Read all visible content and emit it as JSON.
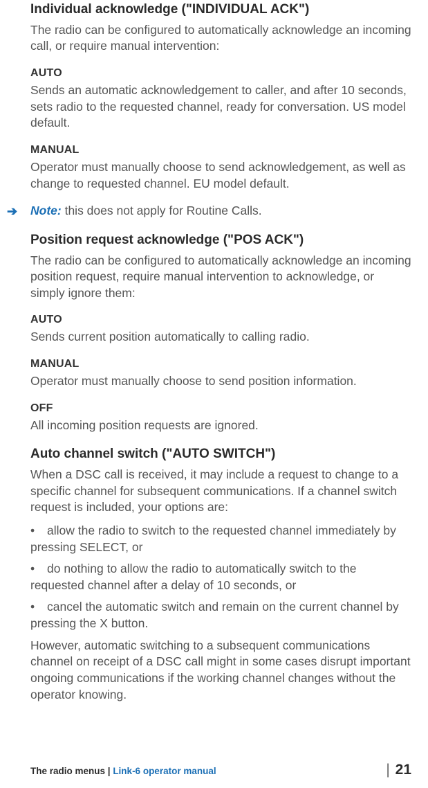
{
  "sections": {
    "individual_ack": {
      "heading": "Individual acknowledge (\"INDIVIDUAL ACK\")",
      "intro": "The radio can be configured to automatically acknowledge an incoming call, or require manual intervention:",
      "auto": {
        "label": "AUTO",
        "text": "Sends an automatic acknowledgement to caller, and after 10 seconds, sets radio to the requested channel, ready for conversation. US model default."
      },
      "manual": {
        "label": "MANUAL",
        "text": "Operator must manually choose to send acknowledgement, as well as change to requested channel. EU model default."
      },
      "note": {
        "label": "Note:",
        "text": " this does not apply for Routine Calls."
      }
    },
    "pos_ack": {
      "heading": "Position request acknowledge (\"POS ACK\")",
      "intro": "The radio can be configured to automatically acknowledge an incoming position request, require manual intervention to acknowledge, or simply ignore them:",
      "auto": {
        "label": "AUTO",
        "text": "Sends current position automatically to calling radio."
      },
      "manual": {
        "label": "MANUAL",
        "text": "Operator must manually choose to send position information."
      },
      "off": {
        "label": "OFF",
        "text": "All incoming position requests are ignored."
      }
    },
    "auto_switch": {
      "heading": "Auto channel switch (\"AUTO SWITCH\")",
      "intro": "When a DSC call is received, it may include a request to change to a specific channel for subsequent communications. If a channel switch request is included, your options are:",
      "bullets": [
        "allow the radio to switch to the requested channel immediately by pressing SELECT, or",
        "do nothing to allow the radio to automatically switch to the requested channel after a delay of 10 seconds, or",
        "cancel the automatic switch and remain on the current channel by pressing the X button."
      ],
      "outro": "However, automatic switching to a subsequent communications channel on receipt of a DSC call might in some cases disrupt important ongoing communications if the working channel changes without the operator knowing."
    }
  },
  "footer": {
    "chapter": "The radio menus | ",
    "manual": "Link-6 operator manual",
    "page_prefix": "| ",
    "page_number": "21"
  }
}
